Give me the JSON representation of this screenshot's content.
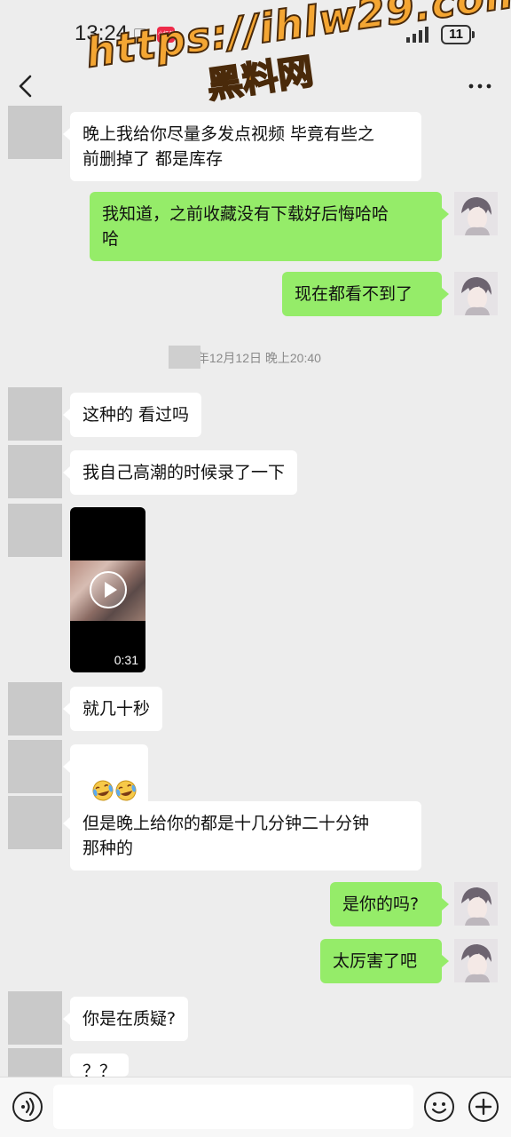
{
  "status_bar": {
    "time": "13:24",
    "app_icon_text": "小红书",
    "battery": "11"
  },
  "watermark": {
    "line1": "https://ihlw29.com",
    "line2": "黑料网"
  },
  "colors": {
    "background": "#ededed",
    "my_bubble": "#95ec69",
    "their_bubble": "#ffffff",
    "watermark_fill": "#f4a633"
  },
  "messages": [
    {
      "side": "left",
      "text": "晚上我给你尽量多发点视频 毕竟有些之\n前删掉了 都是库存"
    },
    {
      "side": "right",
      "text": "我知道，之前收藏没有下载好后悔哈哈\n哈"
    },
    {
      "side": "right",
      "text": "现在都看不到了"
    },
    {
      "side": "left",
      "text": "这种的 看过吗"
    },
    {
      "side": "left",
      "text": "我自己高潮的时候录了一下"
    },
    {
      "side": "left",
      "type": "video",
      "duration": "0:31"
    },
    {
      "side": "left",
      "text": "就几十秒"
    },
    {
      "side": "left",
      "type": "emoji",
      "emoji": [
        "crying-laughing-emoji",
        "crying-laughing-emoji"
      ]
    },
    {
      "side": "left",
      "text": "但是晚上给你的都是十几分钟二十分钟\n那种的"
    },
    {
      "side": "right",
      "text": "是你的吗?"
    },
    {
      "side": "right",
      "text": "太厉害了吧"
    },
    {
      "side": "left",
      "text": "你是在质疑?"
    },
    {
      "side": "left",
      "text": "？？"
    }
  ],
  "timestamp": "3年12月12日 晚上20:40",
  "input_bar": {
    "placeholder": ""
  }
}
